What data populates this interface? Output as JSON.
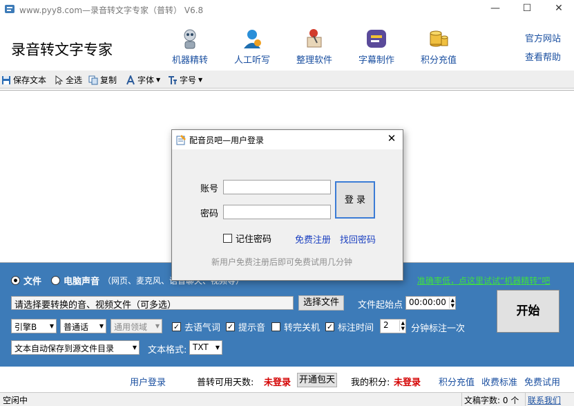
{
  "window": {
    "title": "www.pyy8.com—录音转文字专家（普转） V6.8",
    "minimize": "—",
    "maximize": "☐",
    "close": "✕"
  },
  "header": {
    "app_title": "录音转文字专家",
    "tools": [
      {
        "label": "机器精转",
        "icon": "robot-icon"
      },
      {
        "label": "人工听写",
        "icon": "user-headset-icon"
      },
      {
        "label": "整理软件",
        "icon": "pushpin-icon"
      },
      {
        "label": "字幕制作",
        "icon": "subtitle-icon"
      },
      {
        "label": "积分充值",
        "icon": "coins-icon"
      }
    ],
    "links": {
      "official_site": "官方网站",
      "help": "查看帮助"
    }
  },
  "toolbar": {
    "save": "保存文本",
    "select_all": "全选",
    "copy": "复制",
    "font": "字体",
    "font_size": "字号"
  },
  "dialog": {
    "title": "配音员吧—用户登录",
    "close": "✕",
    "account_label": "账号",
    "account_value": "",
    "password_label": "密码",
    "password_value": "",
    "login": "登 录",
    "remember": "记住密码",
    "register": "免费注册",
    "recover": "找回密码",
    "hint": "新用户免费注册后即可免费试用几分钟"
  },
  "panel": {
    "source_file": "文件",
    "source_pc": "电脑声音",
    "source_pc_note": "（网页、麦克风、语音聊天、视频等）",
    "promo": "准确率低，点这里试试“机器精转”吧",
    "file_input": "请选择要转换的音、视频文件（可多选）",
    "choose_file": "选择文件",
    "start_point_label": "文件起始点",
    "start_point_value": "00:00:00",
    "start": "开始",
    "engine": "引擎B",
    "language": "普通话",
    "domain": "通用领域",
    "opt_remove_particles": "去语气词",
    "opt_prompt_sound": "提示音",
    "opt_shutdown": "转完关机",
    "opt_timestamp": "标注时间",
    "interval_value": "2",
    "interval_suffix": "分钟标注一次",
    "save_mode": "文本自动保存到源文件目录",
    "format_label": "文本格式:",
    "format_value": "TXT"
  },
  "footer": {
    "user_login": "用户登录",
    "days_label": "普转可用天数:",
    "days_value": "未登录",
    "open_package": "开通包天",
    "points_label": "我的积分:",
    "points_value": "未登录",
    "recharge": "积分充值",
    "pricing": "收费标准",
    "free_trial": "免费试用"
  },
  "status": {
    "state": "空闲中",
    "word_count_label": "文稿字数:",
    "word_count_value": "0 个",
    "contact": "联系我们"
  }
}
